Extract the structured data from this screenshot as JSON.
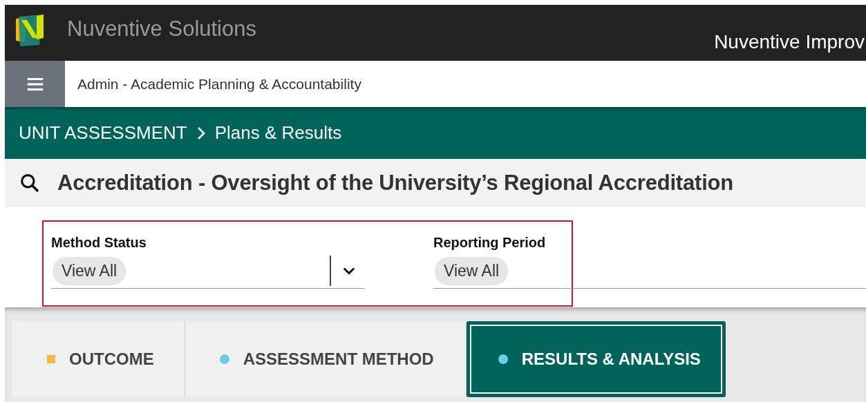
{
  "header": {
    "brand": "Nuventive Solutions",
    "product": "Nuventive Improv"
  },
  "context": {
    "label": "Admin - Academic Planning & Accountability"
  },
  "breadcrumb": [
    {
      "label": "UNIT ASSESSMENT"
    },
    {
      "label": "Plans & Results"
    }
  ],
  "page_title": "Accreditation - Oversight of the University’s Regional Accreditation",
  "filters": {
    "highlighted": true,
    "items": [
      {
        "label": "Method Status",
        "value": "View All",
        "kind": "dropdown"
      },
      {
        "label": "Reporting Period",
        "value": "View All",
        "kind": "plain"
      }
    ]
  },
  "tabs": [
    {
      "label": "OUTCOME",
      "selected": false,
      "kind": "square",
      "color": "#f5b942"
    },
    {
      "label": "ASSESSMENT METHOD",
      "selected": false,
      "kind": "circle",
      "color": "#6ccde6"
    },
    {
      "label": "RESULTS & ANALYSIS",
      "selected": true,
      "kind": "circle",
      "color": "#6ccde6"
    }
  ]
}
